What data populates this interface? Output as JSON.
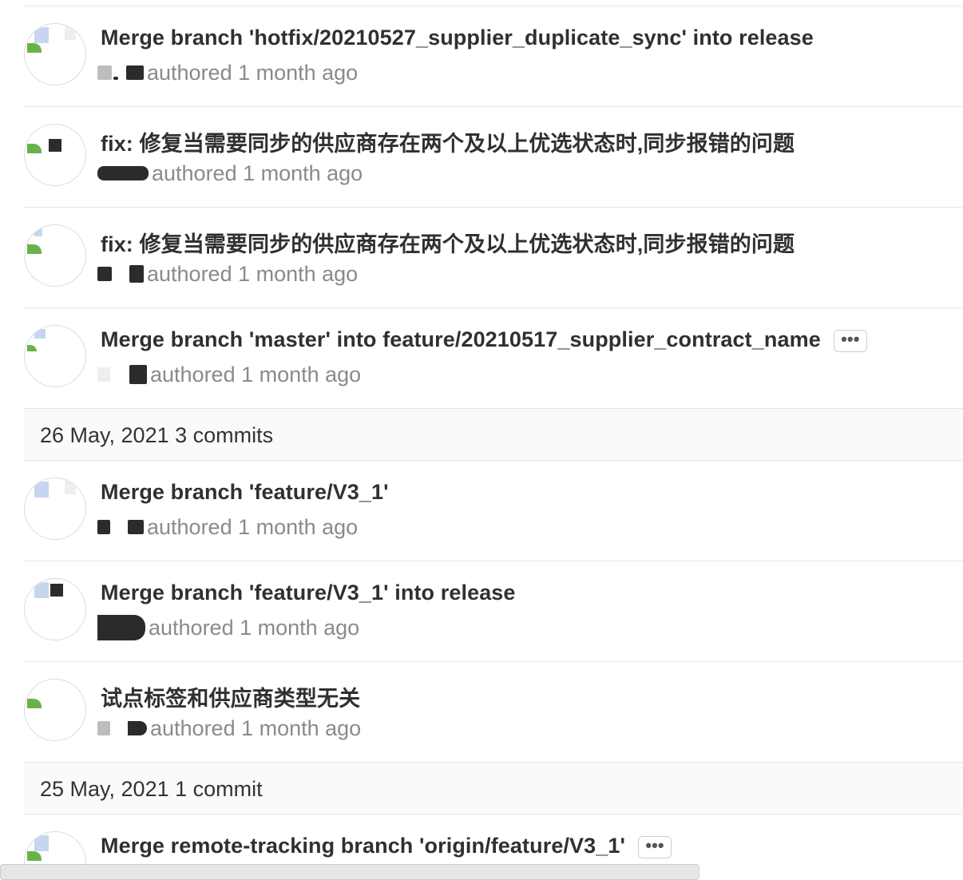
{
  "day_groups": [
    {
      "header": "",
      "commits": [
        {
          "title": "Merge branch 'hotfix/20210527_supplier_duplicate_sync' into release",
          "meta": "authored 1 month ago",
          "has_more": false
        },
        {
          "title": "fix: 修复当需要同步的供应商存在两个及以上优选状态时,同步报错的问题",
          "meta": "authored 1 month ago",
          "has_more": false
        },
        {
          "title": "fix: 修复当需要同步的供应商存在两个及以上优选状态时,同步报错的问题",
          "meta": "authored 1 month ago",
          "has_more": false
        },
        {
          "title": "Merge branch 'master' into feature/20210517_supplier_contract_name",
          "meta": "authored 1 month ago",
          "has_more": true
        }
      ]
    },
    {
      "header": "26 May, 2021 3 commits",
      "commits": [
        {
          "title": "Merge branch 'feature/V3_1'",
          "meta": "authored 1 month ago",
          "has_more": false
        },
        {
          "title": "Merge branch 'feature/V3_1' into release",
          "meta": "authored 1 month ago",
          "has_more": false
        },
        {
          "title": "试点标签和供应商类型无关",
          "meta": "authored 1 month ago",
          "has_more": false
        }
      ]
    },
    {
      "header": "25 May, 2021 1 commit",
      "commits": [
        {
          "title": "Merge remote-tracking branch 'origin/feature/V3_1'",
          "meta": "",
          "has_more": true
        }
      ]
    }
  ],
  "more_button_label": "•••",
  "colors": {
    "title": "#303030",
    "meta": "#8a8a8a",
    "divider": "#e5e5e5",
    "day_header_bg": "#fafafa"
  },
  "icons": {
    "avatar": "user-avatar-icon",
    "more": "ellipsis-icon"
  }
}
